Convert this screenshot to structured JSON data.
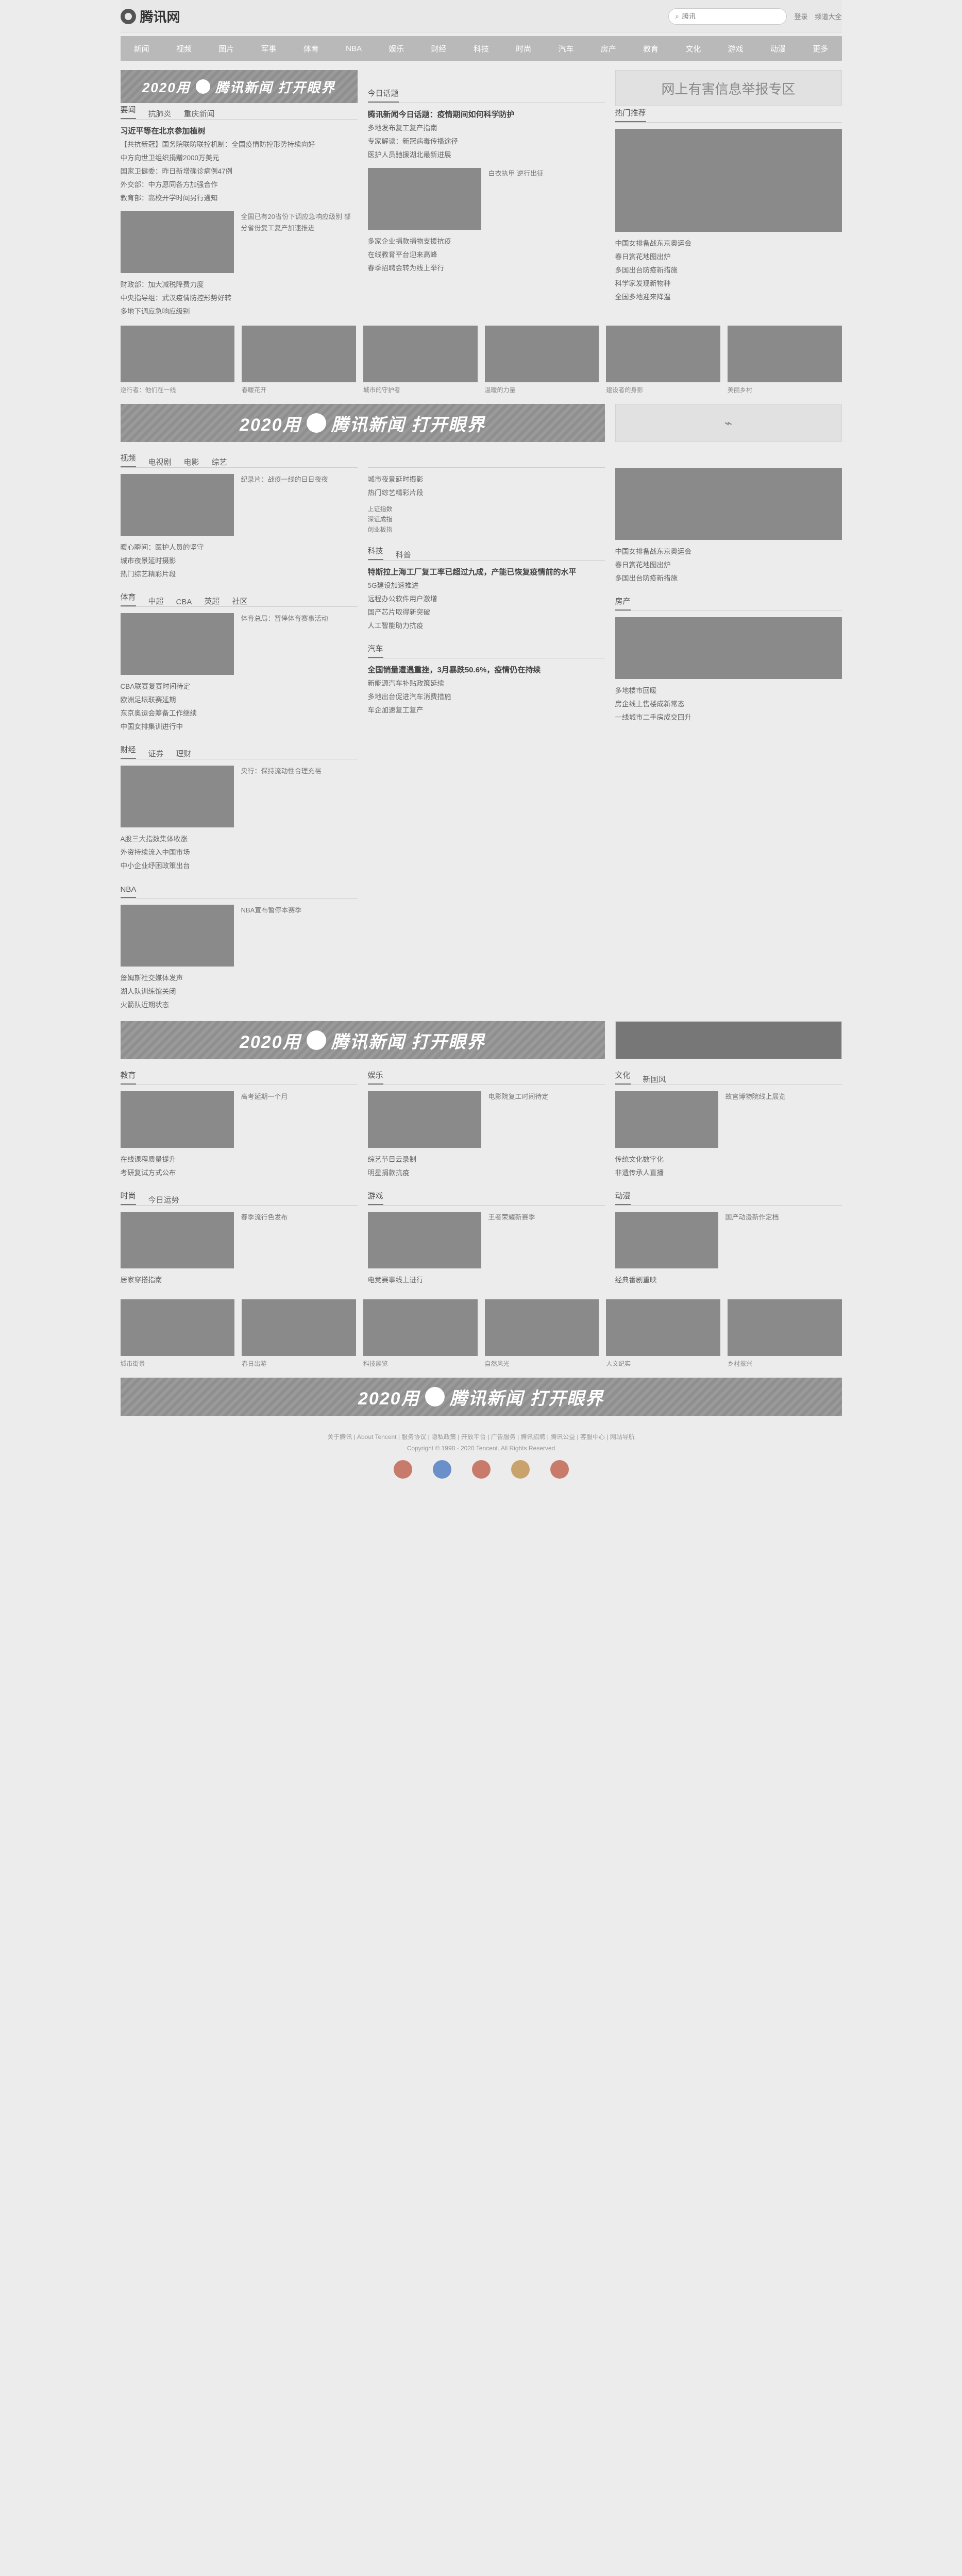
{
  "header": {
    "logo": "腾讯网",
    "search_placeholder": "腾讯",
    "links": [
      "登录",
      "频道大全"
    ]
  },
  "nav": [
    "新闻",
    "视频",
    "图片",
    "军事",
    "体育",
    "NBA",
    "娱乐",
    "财经",
    "科技",
    "时尚",
    "汽车",
    "房产",
    "教育",
    "文化",
    "游戏",
    "动漫",
    "更多"
  ],
  "banner": {
    "left": "2020用",
    "brand": "腾讯新闻",
    "right": "打开眼界"
  },
  "news": {
    "tabs": [
      "要闻",
      "抗肺炎",
      "重庆新闻"
    ],
    "headline": "习近平等在北京参加植树",
    "items": [
      "【共抗新冠】国务院联防联控机制：全国疫情防控形势持续向好",
      "中方向世卫组织捐赠2000万美元",
      "国家卫健委：昨日新增确诊病例47例",
      "外交部：中方愿同各方加强合作",
      "教育部：高校开学时间另行通知",
      "财政部：加大减税降费力度",
      "中央指导组：武汉疫情防控形势好转",
      "多地下调应急响应级别"
    ],
    "pic_text": "全国已有20省份下调应急响应级别 部分省份复工复产加速推进"
  },
  "today": {
    "tabs": [
      "今日话题"
    ],
    "headline": "腾讯新闻今日话题：疫情期间如何科学防护",
    "items": [
      "多地发布复工复产指南",
      "专家解读：新冠病毒传播途径",
      "医护人员驰援湖北最新进展",
      "多家企业捐款捐物支援抗疫",
      "在线教育平台迎来高峰",
      "春季招聘会转为线上举行"
    ],
    "pic_text": "白衣执甲 逆行出征"
  },
  "hot": {
    "title": "热门推荐",
    "ad": "网上有害信息举报专区",
    "items": [
      "中国女排备战东京奥运会",
      "春日赏花地图出炉",
      "多国出台防疫新措施",
      "科学家发现新物种",
      "全国多地迎来降温"
    ]
  },
  "video": {
    "tabs": [
      "视频",
      "电视剧",
      "电影",
      "综艺"
    ],
    "items": [
      "纪录片：战疫一线的日日夜夜",
      "暖心瞬间：医护人员的坚守",
      "城市夜景延时摄影",
      "热门综艺精彩片段"
    ]
  },
  "strip1": [
    "逆行者：他们在一线",
    "春暖花开",
    "城市的守护者",
    "温暖的力量",
    "建设者的身影",
    "美丽乡村"
  ],
  "sports": {
    "tabs": [
      "体育",
      "中超",
      "CBA",
      "英超",
      "社区"
    ],
    "items": [
      "体育总局：暂停体育赛事活动",
      "CBA联赛复赛时间待定",
      "欧洲足坛联赛延期",
      "东京奥运会筹备工作继续",
      "中国女排集训进行中"
    ]
  },
  "finance": {
    "tabs": [
      "财经",
      "证券",
      "理财"
    ],
    "items": [
      "央行：保持流动性合理充裕",
      "A股三大指数集体收涨",
      "外资持续流入中国市场",
      "中小企业纾困政策出台"
    ],
    "quote": [
      "上证指数",
      "深证成指",
      "创业板指"
    ]
  },
  "nba": {
    "tabs": [
      "NBA"
    ],
    "items": [
      "NBA宣布暂停本赛季",
      "詹姆斯社交媒体发声",
      "湖人队训练馆关闭",
      "火箭队近期状态"
    ]
  },
  "tech": {
    "tabs": [
      "科技",
      "科普"
    ],
    "items": [
      "5G建设加速推进",
      "远程办公软件用户激增",
      "国产芯片取得新突破",
      "人工智能助力抗疫"
    ],
    "headline": "特斯拉上海工厂复工率已超过九成，产能已恢复疫情前的水平"
  },
  "auto": {
    "tabs": [
      "汽车"
    ],
    "headline": "全国销量遭遇重挫，3月暴跌50.6%，疫情仍在持续",
    "items": [
      "新能源汽车补贴政策延续",
      "多地出台促进汽车消费措施",
      "车企加速复工复产"
    ]
  },
  "house": {
    "tabs": [
      "房产"
    ],
    "items": [
      "多地楼市回暖",
      "房企线上售楼成新常态",
      "一线城市二手房成交回升"
    ]
  },
  "edu": {
    "tabs": [
      "教育"
    ],
    "items": [
      "高考延期一个月",
      "在线课程质量提升",
      "考研复试方式公布"
    ]
  },
  "ent": {
    "tabs": [
      "娱乐"
    ],
    "items": [
      "电影院复工时间待定",
      "综艺节目云录制",
      "明星捐款抗疫"
    ]
  },
  "culture": {
    "tabs": [
      "文化",
      "新国风"
    ],
    "items": [
      "故宫博物院线上展览",
      "传统文化数字化",
      "非遗传承人直播"
    ]
  },
  "fashion": {
    "tabs": [
      "时尚",
      "今日运势"
    ],
    "items": [
      "春季流行色发布",
      "居家穿搭指南"
    ]
  },
  "game": {
    "tabs": [
      "游戏"
    ],
    "items": [
      "王者荣耀新赛季",
      "电竞赛事线上进行"
    ]
  },
  "comic": {
    "tabs": [
      "动漫"
    ],
    "items": [
      "国产动漫新作定档",
      "经典番剧重映"
    ]
  },
  "strip2": [
    "城市街景",
    "春日出游",
    "科技展览",
    "自然风光",
    "人文纪实",
    "乡村振兴"
  ],
  "footer": {
    "links": "关于腾讯 | About Tencent | 服务协议 | 隐私政策 | 开放平台 | 广告服务 | 腾讯招聘 | 腾讯公益 | 客服中心 | 网站导航",
    "copyright": "Copyright © 1998 - 2020 Tencent. All Rights Reserved"
  }
}
